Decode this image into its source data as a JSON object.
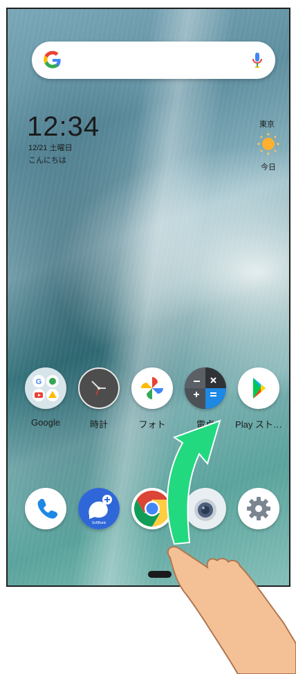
{
  "search": {
    "logo_letter": "G",
    "icon_left": "google-g-icon",
    "icon_right": "mic-icon"
  },
  "clock": {
    "time": "12:34",
    "date": "12/21 土曜日",
    "greeting": "こんにちは"
  },
  "weather": {
    "city": "東京",
    "day": "今日",
    "icon": "sun-icon"
  },
  "apps_row": [
    {
      "label": "Google",
      "icon": "google-folder-icon"
    },
    {
      "label": "時計",
      "icon": "clock-app-icon"
    },
    {
      "label": "フォト",
      "icon": "photos-icon"
    },
    {
      "label": "電卓",
      "icon": "calculator-icon"
    },
    {
      "label": "Play スト…",
      "icon": "play-store-icon"
    }
  ],
  "dock": [
    {
      "icon": "phone-icon"
    },
    {
      "icon": "plus-message-icon",
      "caption": "SoftBank"
    },
    {
      "icon": "chrome-icon"
    },
    {
      "icon": "camera-icon"
    },
    {
      "icon": "settings-icon"
    }
  ],
  "colors": {
    "gesture_arrow": "#22d97f",
    "navigation_handle": "#1a1a1a"
  }
}
